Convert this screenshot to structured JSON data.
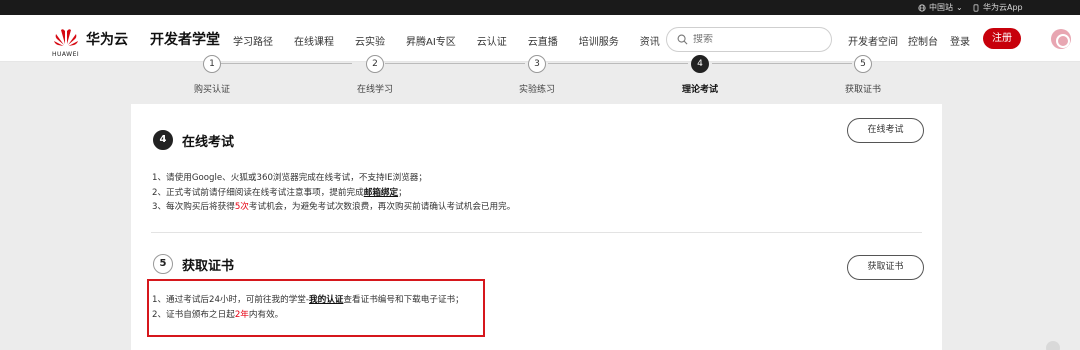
{
  "topbar": {
    "region": "中国站",
    "app": "华为云App"
  },
  "header": {
    "logo_text": "HUAWEI",
    "brand": "华为云",
    "section_title": "开发者学堂",
    "nav": [
      "学习路径",
      "在线课程",
      "云实验",
      "昇腾AI专区",
      "云认证",
      "云直播",
      "培训服务",
      "资讯"
    ],
    "search_placeholder": "搜索",
    "dev_space": "开发者空间",
    "console": "控制台",
    "login": "登录",
    "register": "注册"
  },
  "steps": [
    {
      "num": "1",
      "label": "购买认证"
    },
    {
      "num": "2",
      "label": "在线学习"
    },
    {
      "num": "3",
      "label": "实验练习"
    },
    {
      "num": "4",
      "label": "理论考试",
      "active": true
    },
    {
      "num": "5",
      "label": "获取证书"
    }
  ],
  "exam": {
    "num": "4",
    "title": "在线考试",
    "button": "在线考试",
    "line1": "1、请使用Google、火狐或360浏览器完成在线考试，不支持IE浏览器；",
    "line2_a": "2、正式考试前请仔细阅读在线考试注意事项，提前完成",
    "line2_link": "邮箱绑定",
    "line2_b": "；",
    "line3_a": "3、每次购买后将获得",
    "line3_red": "5次",
    "line3_b": "考试机会，为避免考试次数浪费，再次购买前请确认考试机会已用完。"
  },
  "cert": {
    "num": "5",
    "title": "获取证书",
    "button": "获取证书",
    "line1_a": "1、通过考试后24小时，可前往我的学堂-",
    "line1_link": "我的认证",
    "line1_b": "查看证书编号和下载电子证书；",
    "line2_a": "2、证书自颁布之日起",
    "line2_red": "2年",
    "line2_b": "内有效。"
  },
  "colors": {
    "brand_red": "#c7000b",
    "highlight_red": "#e60012",
    "annotation_box": "#d6171c"
  }
}
